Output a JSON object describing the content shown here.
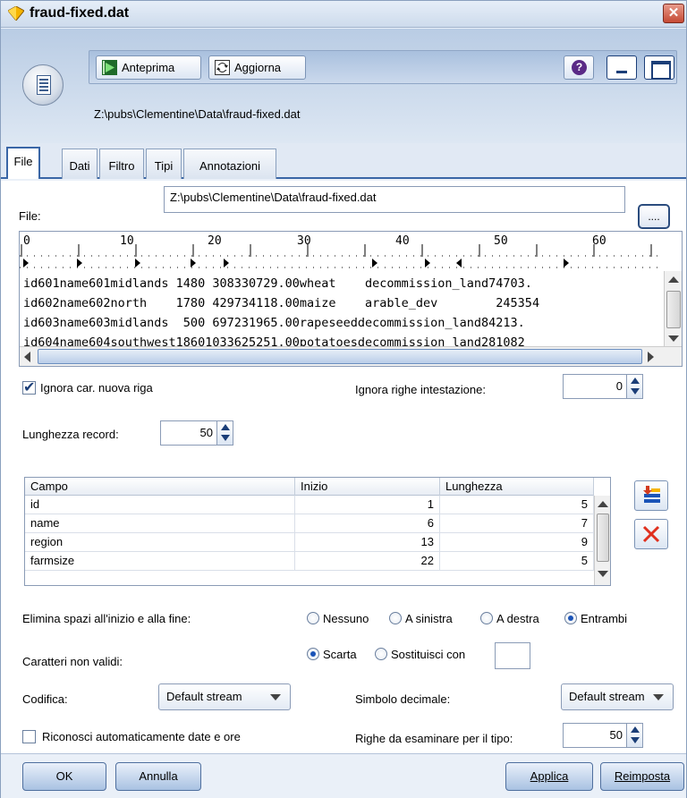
{
  "window": {
    "title": "fraud-fixed.dat",
    "close_glyph": "✕",
    "path_label": "Z:\\pubs\\Clementine\\Data\\fraud-fixed.dat"
  },
  "toolbar": {
    "preview_label": "Anteprima",
    "refresh_label": "Aggiorna",
    "help_glyph": "?"
  },
  "tabs": [
    {
      "label": "File"
    },
    {
      "label": "Dati"
    },
    {
      "label": "Filtro"
    },
    {
      "label": "Tipi"
    },
    {
      "label": "Annotazioni"
    }
  ],
  "file": {
    "label": "File:",
    "value": "Z:\\pubs\\Clementine\\Data\\fraud-fixed.dat",
    "browse_label": "...."
  },
  "preview": {
    "ruler_numbers": [
      "0",
      "10",
      "20",
      "30",
      "40",
      "50",
      "60"
    ],
    "lines": [
      "id601name601midlands 1480 308330729.00wheat    decommission_land74703.",
      "id602name602north    1780 429734118.00maize    arable_dev        245354",
      "id603name603midlands  500 697231965.00rapeseeddecommission_land84213.",
      "id604name604southwest18601033625251.00potatoesdecommission_land281082"
    ]
  },
  "options": {
    "ignore_newline_label": "Ignora car. nuova riga",
    "ignore_newline_checked": true,
    "skip_header_label": "Ignora righe intestazione:",
    "skip_header_value": "0",
    "record_length_label": "Lunghezza record:",
    "record_length_value": "50"
  },
  "fields_table": {
    "headers": [
      "Campo",
      "Inizio",
      "Lunghezza"
    ],
    "rows": [
      {
        "field": "id",
        "start": "1",
        "length": "5"
      },
      {
        "field": "name",
        "start": "6",
        "length": "7"
      },
      {
        "field": "region",
        "start": "13",
        "length": "9"
      },
      {
        "field": "farmsize",
        "start": "22",
        "length": "5"
      }
    ]
  },
  "trim": {
    "label": "Elimina spazi all'inizio e alla fine:",
    "options": [
      "Nessuno",
      "A sinistra",
      "A destra",
      "Entrambi"
    ],
    "selected": "Entrambi"
  },
  "invalid_chars": {
    "label": "Caratteri non validi:",
    "options": [
      "Scarta",
      "Sostituisci con"
    ],
    "selected": "Scarta"
  },
  "encoding": {
    "label": "Codifica:",
    "value": "Default stream"
  },
  "decimal": {
    "label": "Simbolo decimale:",
    "value": "Default stream"
  },
  "auto_dates": {
    "label": "Riconosci automaticamente date e ore",
    "checked": false
  },
  "type_rows": {
    "label": "Righe da esaminare per il tipo:",
    "value": "50"
  },
  "footer": {
    "ok_label": "OK",
    "cancel_label": "Annulla",
    "apply_label": "Applica",
    "reset_label": "Reimposta"
  },
  "colors": {
    "accent": "#3a66a6",
    "header_bg": "#b9cce4",
    "delete_red": "#e0301e"
  }
}
